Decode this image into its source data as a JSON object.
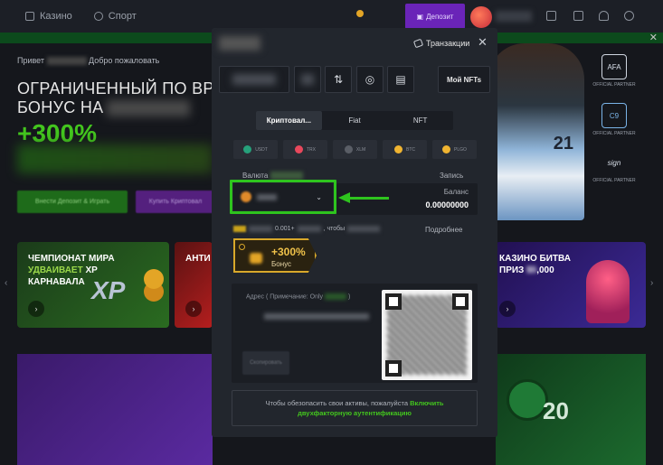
{
  "nav": {
    "casino": "Казино",
    "sport": "Спорт",
    "deposit": "Депозит"
  },
  "hero": {
    "greeting_prefix": "Привет",
    "greeting_suffix": "Добро пожаловать",
    "title_line1": "ОГРАНИЧЕННЫЙ ПО ВР",
    "title_line2": "БОНУС НА",
    "percent": "+300%",
    "btn1": "Внести Депозит & Играть",
    "btn2": "Купить Криптовал"
  },
  "player": {
    "number": "21"
  },
  "partners": [
    {
      "logo": "AFA",
      "label": "OFFICIAL PARTNER"
    },
    {
      "logo": "C9",
      "label": "OFFICIAL PARTNER"
    },
    {
      "logo": "sign",
      "label": "OFFICIAL PARTNER"
    }
  ],
  "promos": {
    "card1": {
      "line1": "ЧЕМПИОНАТ МИРА",
      "accent": "УДВАИВАЕТ",
      "line2_rest": " XP",
      "line3": "КАРНАВАЛА",
      "badge": "XP"
    },
    "card2": {
      "line1": "АНТИ"
    },
    "card3": {
      "line1": "КАЗИНО БИТВА",
      "line2_prefix": "ПРИЗ",
      "line2_blur": "$5",
      "line2_suffix": ",000"
    }
  },
  "modal": {
    "transactions": "Транзакции",
    "nft_button": "Мой NFTs",
    "tabs": [
      "Криптовал...",
      "Fiat",
      "NFT"
    ],
    "coins": [
      {
        "code": "USDT",
        "color": "#26a17b"
      },
      {
        "code": "TRX",
        "color": "#e8485c"
      },
      {
        "code": "XLM",
        "color": "#5a5e66"
      },
      {
        "code": "BTC",
        "color": "#f0b431"
      },
      {
        "code": "PLGO",
        "color": "#f0b431"
      }
    ],
    "currency_label": "Валюта",
    "record_label": "Запись",
    "balance_label": "Баланс",
    "balance_value": "0.00000000",
    "deposit_min": "0.001+",
    "deposit_middle": ", чтобы",
    "more_link": "Подробнее",
    "bonus_percent": "+300%",
    "bonus_label": "Бонус",
    "address_label": "Адрес ( Примечание: Only",
    "address_suffix": ")",
    "copy_button": "Скопировать",
    "twofa_text": "Чтобы обезопасить свои активы, пожалуйста",
    "twofa_link1": "Включить",
    "twofa_link2": "двухфакторную аутентификацию"
  },
  "colors": {
    "accent_green": "#43c51e",
    "highlight_green": "#2ec41e",
    "deposit_purple": "#6a24b8",
    "bonus_gold": "#d8a82a"
  }
}
